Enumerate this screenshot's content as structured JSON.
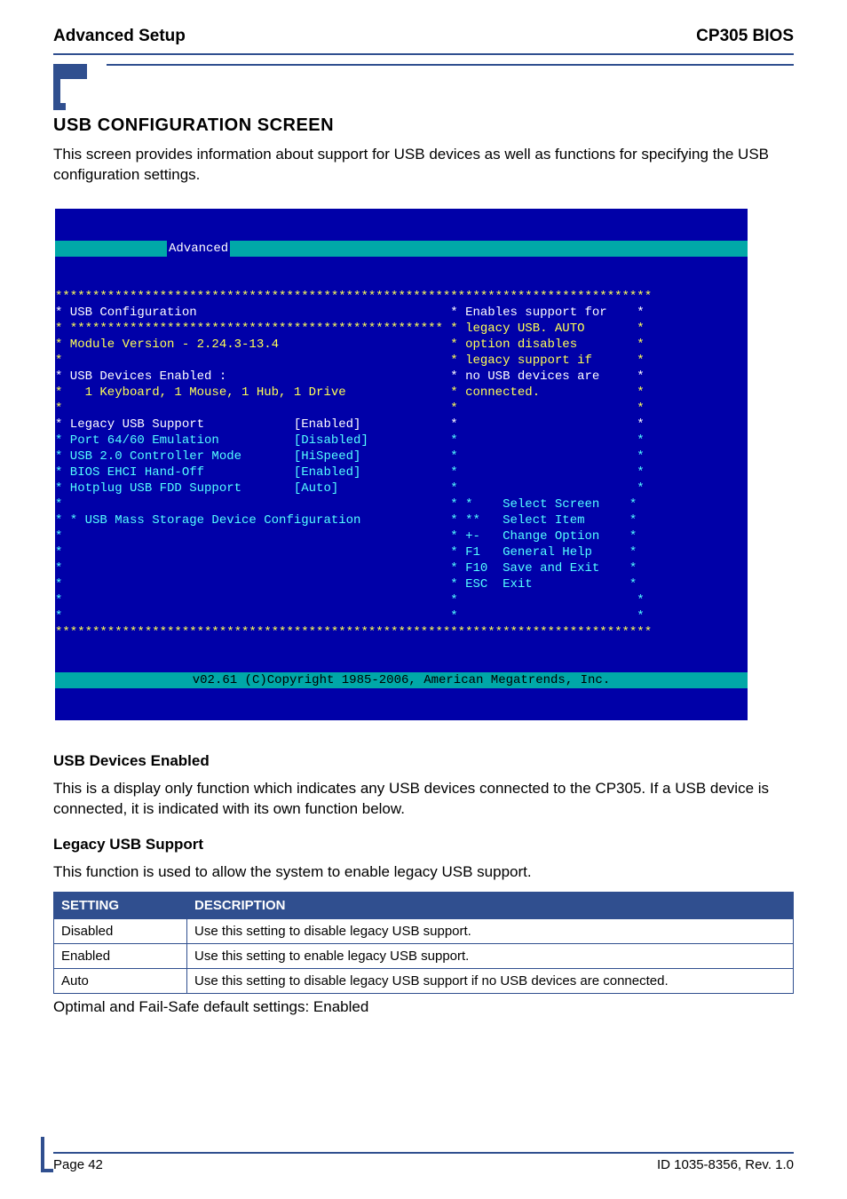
{
  "header": {
    "left": "Advanced Setup",
    "right": "CP305 BIOS"
  },
  "section": {
    "title": "USB CONFIGURATION SCREEN",
    "intro": "This screen provides information about support for USB devices as well as functions for specifying the USB configuration settings."
  },
  "bios": {
    "tab": "Advanced",
    "line_stars_top": "********************************************************************************",
    "line_title": "* USB Configuration                                  * Enables support for    *",
    "line_sub_sep": "* ************************************************** * legacy USB. AUTO       *",
    "line_module": "* Module Version - 2.24.3-13.4                       * option disables        *",
    "line_opt2": "*                                                    * legacy support if      *",
    "line_dev_en": "* USB Devices Enabled :                              * no USB devices are     *",
    "line_dev_ls": "*   1 Keyboard, 1 Mouse, 1 Hub, 1 Drive              * connected.             *",
    "line_blank1": "*                                                    *                        *",
    "line_legacy": "* Legacy USB Support            [Enabled]            *                        *",
    "line_port": "* Port 64/60 Emulation          [Disabled]           *                        *",
    "line_usb20": "* USB 2.0 Controller Mode       [HiSpeed]            *                        *",
    "line_ehci": "* BIOS EHCI Hand-Off            [Enabled]            *                        *",
    "line_hotplug": "* Hotplug USB FDD Support       [Auto]               *                        *",
    "line_help1": "*                                                    * *    Select Screen    *",
    "line_mass": "* * USB Mass Storage Device Configuration            * **   Select Item      *",
    "line_help3": "*                                                    * +-   Change Option    *",
    "line_help4": "*                                                    * F1   General Help     *",
    "line_help5": "*                                                    * F10  Save and Exit    *",
    "line_help6": "*                                                    * ESC  Exit             *",
    "line_blank2": "*                                                    *                        *",
    "line_blank3": "*                                                    *                        *",
    "line_stars_bot": "********************************************************************************",
    "copyright": "v02.61 (C)Copyright 1985-2006, American Megatrends, Inc."
  },
  "chart_data": {
    "type": "table",
    "title": "BIOS USB Configuration options",
    "options": [
      {
        "name": "Legacy USB Support",
        "value": "Enabled"
      },
      {
        "name": "Port 64/60 Emulation",
        "value": "Disabled"
      },
      {
        "name": "USB 2.0 Controller Mode",
        "value": "HiSpeed"
      },
      {
        "name": "BIOS EHCI Hand-Off",
        "value": "Enabled"
      },
      {
        "name": "Hotplug USB FDD Support",
        "value": "Auto"
      }
    ],
    "module_version": "2.24.3-13.4",
    "usb_devices_enabled": "1 Keyboard, 1 Mouse, 1 Hub, 1 Drive",
    "help_text": "Enables support for legacy USB. AUTO option disables legacy support if no USB devices are connected.",
    "key_hints": [
      {
        "key": "*",
        "action": "Select Screen"
      },
      {
        "key": "**",
        "action": "Select Item"
      },
      {
        "key": "+-",
        "action": "Change Option"
      },
      {
        "key": "F1",
        "action": "General Help"
      },
      {
        "key": "F10",
        "action": "Save and Exit"
      },
      {
        "key": "ESC",
        "action": "Exit"
      }
    ]
  },
  "usb_devices": {
    "title": "USB Devices Enabled",
    "text": "This is a display only function which indicates any USB devices connected to the CP305. If a USB device is connected, it is indicated with its own function below."
  },
  "legacy_usb": {
    "title": "Legacy USB Support",
    "text": "This function is used to allow the system to enable legacy USB support.",
    "table": {
      "col1": "SETTING",
      "col2": "DESCRIPTION",
      "rows": [
        {
          "c1": "Disabled",
          "c2": "Use this setting to disable legacy USB support."
        },
        {
          "c1": "Enabled",
          "c2": "Use this setting to enable legacy USB support."
        },
        {
          "c1": "Auto",
          "c2": "Use this setting to disable legacy USB support if no USB devices are connected."
        }
      ]
    },
    "defaults": "Optimal and Fail-Safe default settings: Enabled"
  },
  "footer": {
    "left": "Page 42",
    "right": "ID 1035-8356, Rev. 1.0"
  }
}
